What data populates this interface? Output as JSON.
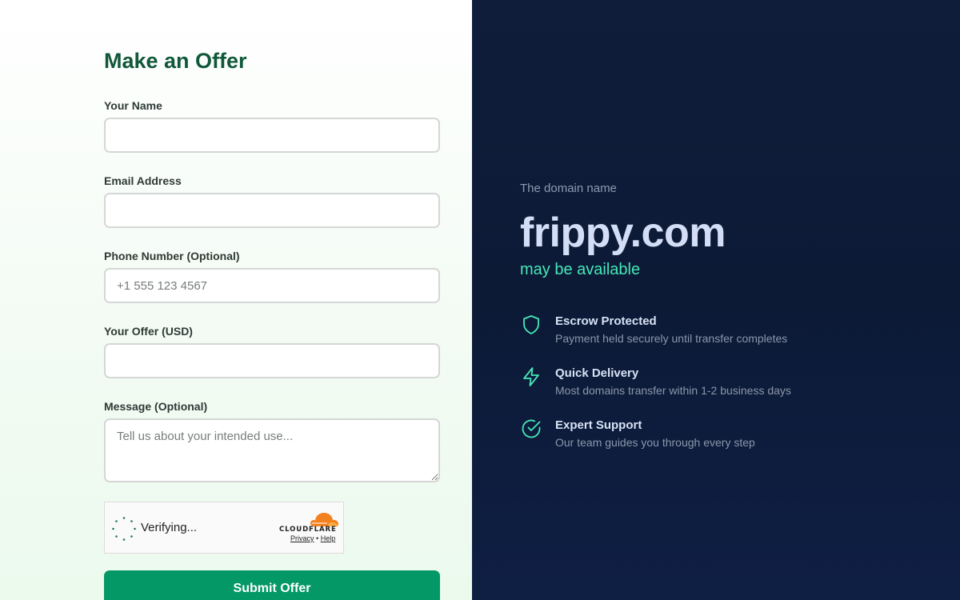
{
  "form": {
    "title": "Make an Offer",
    "name_label": "Your Name",
    "name_value": "",
    "email_label": "Email Address",
    "email_value": "",
    "phone_label": "Phone Number (Optional)",
    "phone_placeholder": "+1 555 123 4567",
    "offer_label": "Your Offer (USD)",
    "offer_value": "",
    "message_label": "Message (Optional)",
    "message_placeholder": "Tell us about your intended use...",
    "submit_label": "Submit Offer"
  },
  "captcha": {
    "status": "Verifying...",
    "brand": "CLOUDFLARE",
    "privacy_link": "Privacy",
    "separator": "•",
    "help_link": "Help",
    "brand_color": "#f48120"
  },
  "hero": {
    "intro": "The domain name",
    "domain": "frippy.com",
    "availability": "may be available"
  },
  "features": [
    {
      "icon": "shield-icon",
      "title": "Escrow Protected",
      "description": "Payment held securely until transfer completes"
    },
    {
      "icon": "lightning-icon",
      "title": "Quick Delivery",
      "description": "Most domains transfer within 1-2 business days"
    },
    {
      "icon": "check-circle-icon",
      "title": "Expert Support",
      "description": "Our team guides you through every step"
    }
  ],
  "colors": {
    "primary_green": "#049866",
    "title_green": "#11583a",
    "accent_teal": "#46e8b8",
    "panel_navy": "#0f1d3b"
  }
}
